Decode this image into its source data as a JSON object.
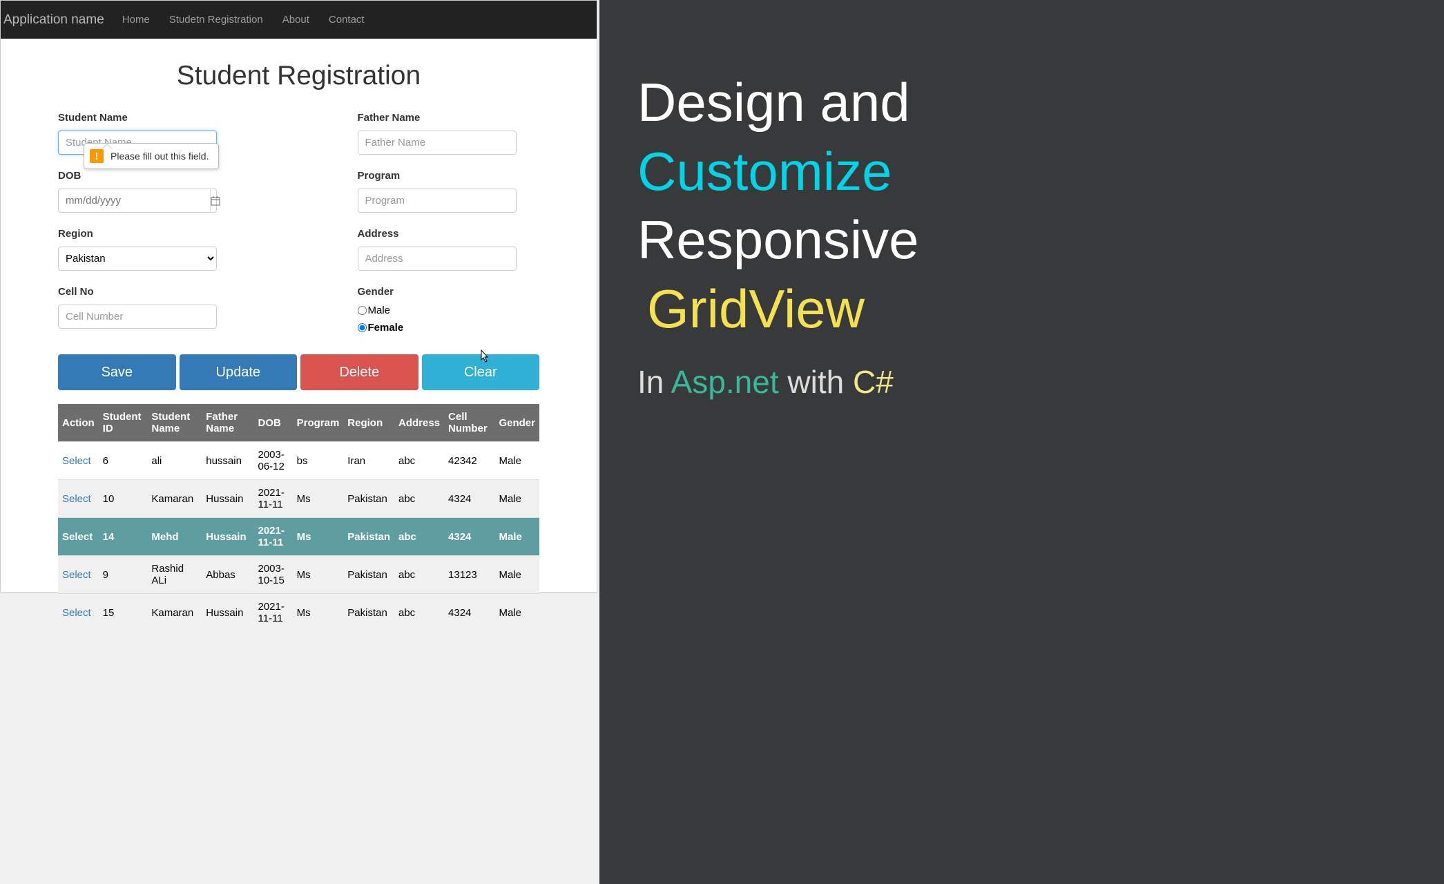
{
  "navbar": {
    "brand": "Application name",
    "links": [
      "Home",
      "Studetn Registration",
      "About",
      "Contact"
    ]
  },
  "page": {
    "title": "Student Registration"
  },
  "form": {
    "student_name": {
      "label": "Student Name",
      "placeholder": "Student Name"
    },
    "father_name": {
      "label": "Father Name",
      "placeholder": "Father Name"
    },
    "dob": {
      "label": "DOB",
      "placeholder": "mm/dd/yyyy"
    },
    "program": {
      "label": "Program",
      "placeholder": "Program"
    },
    "region": {
      "label": "Region",
      "selected": "Pakistan"
    },
    "address": {
      "label": "Address",
      "placeholder": "Address"
    },
    "cell_no": {
      "label": "Cell No",
      "placeholder": "Cell Number"
    },
    "gender": {
      "label": "Gender",
      "male": "Male",
      "female": "Female"
    }
  },
  "tooltip": {
    "text": "Please fill out this field."
  },
  "buttons": {
    "save": "Save",
    "update": "Update",
    "delete": "Delete",
    "clear": "Clear"
  },
  "table": {
    "headers": [
      "Action",
      "Student ID",
      "Student Name",
      "Father Name",
      "DOB",
      "Program",
      "Region",
      "Address",
      "Cell Number",
      "Gender"
    ],
    "select_label": "Select",
    "rows": [
      {
        "id": "6",
        "sname": "ali",
        "fname": "hussain",
        "dob": "2003-06-12",
        "program": "bs",
        "region": "Iran",
        "address": "abc",
        "cell": "42342",
        "gender": "Male",
        "selected": false
      },
      {
        "id": "10",
        "sname": "Kamaran",
        "fname": "Hussain",
        "dob": "2021-11-11",
        "program": "Ms",
        "region": "Pakistan",
        "address": "abc",
        "cell": "4324",
        "gender": "Male",
        "selected": false
      },
      {
        "id": "14",
        "sname": "Mehd",
        "fname": "Hussain",
        "dob": "2021-11-11",
        "program": "Ms",
        "region": "Pakistan",
        "address": "abc",
        "cell": "4324",
        "gender": "Male",
        "selected": true
      },
      {
        "id": "9",
        "sname": "Rashid ALi",
        "fname": "Abbas",
        "dob": "2003-10-15",
        "program": "Ms",
        "region": "Pakistan",
        "address": "abc",
        "cell": "13123",
        "gender": "Male",
        "selected": false
      },
      {
        "id": "15",
        "sname": "Kamaran",
        "fname": "Hussain",
        "dob": "2021-11-11",
        "program": "Ms",
        "region": "Pakistan",
        "address": "abc",
        "cell": "4324",
        "gender": "Male",
        "selected": false
      }
    ]
  },
  "promo": {
    "l1": "Design and",
    "l2": "Customize",
    "l3": "Responsive",
    "l4": "GridView",
    "sub_in": "In ",
    "sub_asp": "Asp.net",
    "sub_with": " with ",
    "sub_cs": "C#"
  }
}
